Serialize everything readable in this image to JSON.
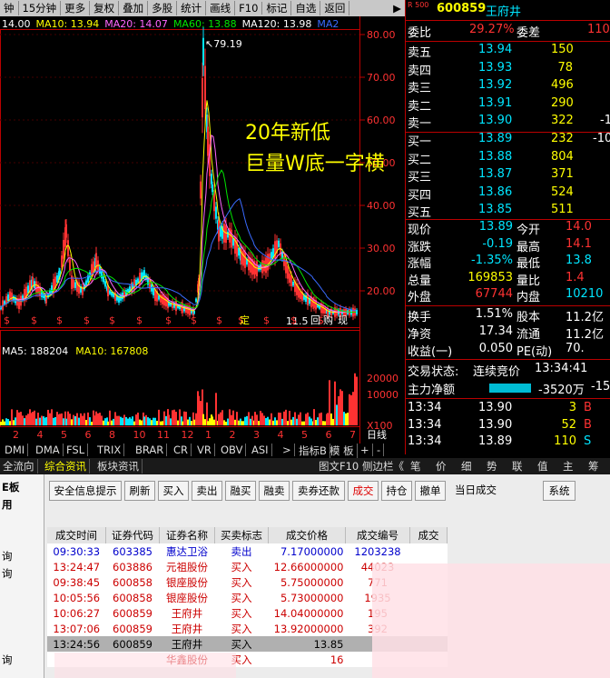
{
  "toolbar": {
    "items": [
      "钟",
      "15分钟",
      "更多",
      "复权",
      "叠加",
      "多股",
      "统计",
      "画线",
      "F10",
      "标记",
      "自选",
      "返回"
    ],
    "scroll_arrow": "▶"
  },
  "chart": {
    "ma_labels": [
      {
        "text": "14.00",
        "color": "#ffffff"
      },
      {
        "text": "MA10: 13.94",
        "color": "#ffff00"
      },
      {
        "text": "MA20: 14.07",
        "color": "#ff66ff"
      },
      {
        "text": "MA60: 13.88",
        "color": "#00e600"
      },
      {
        "text": "MA120: 13.98",
        "color": "#ffffff"
      },
      {
        "text": "MA2",
        "color": "#3a6bff"
      }
    ],
    "price_ticks": [
      "80.00",
      "70.00",
      "60.00",
      "50.00",
      "40.00",
      "30.00",
      "20.00"
    ],
    "high_label": "79.19",
    "low_label": "11.5",
    "annotation_line1": "20年新低",
    "annotation_line2": "巨量W底一字横",
    "marker_chars": [
      "$",
      "定",
      "回",
      "购",
      "现"
    ],
    "vol_labels": [
      {
        "text": "MA5: 188204",
        "color": "#ffffff"
      },
      {
        "text": "MA10: 167808",
        "color": "#ffff00"
      }
    ],
    "vol_ticks": [
      "20000",
      "10000",
      "X100"
    ],
    "x_labels": [
      "2",
      "4",
      "5",
      "6",
      "8",
      "10",
      "11",
      "12",
      "1",
      "2",
      "3",
      "4",
      "5",
      "6",
      "7"
    ],
    "x_unit": "日线",
    "colors": {
      "up": "#ff3232",
      "down": "#00e5ff",
      "ma10": "#ffff00",
      "ma20": "#ff66ff",
      "ma60": "#00e600",
      "ma_long": "#3a6bff"
    }
  },
  "indicator_tabs": [
    "DMI",
    "DMA",
    "FSL",
    "TRIX",
    "BRAR",
    "CR",
    "VR",
    "OBV",
    "ASI",
    ">",
    "指标B",
    "模 板",
    "+",
    "-"
  ],
  "quote": {
    "code": "600859",
    "name": "王府井",
    "tag": "R 500",
    "weibi_label": "委比",
    "weibi_value": "29.27%",
    "weicha_label": "委差",
    "weicha_value": "110",
    "asks": [
      {
        "label": "卖五",
        "price": "13.94",
        "vol": "150",
        "extra": ""
      },
      {
        "label": "卖四",
        "price": "13.93",
        "vol": "78",
        "extra": ""
      },
      {
        "label": "卖三",
        "price": "13.92",
        "vol": "496",
        "extra": ""
      },
      {
        "label": "卖二",
        "price": "13.91",
        "vol": "290",
        "extra": ""
      },
      {
        "label": "卖一",
        "price": "13.90",
        "vol": "322",
        "extra": "-1"
      }
    ],
    "bids": [
      {
        "label": "买一",
        "price": "13.89",
        "vol": "232",
        "extra": "-10"
      },
      {
        "label": "买二",
        "price": "13.88",
        "vol": "804",
        "extra": ""
      },
      {
        "label": "买三",
        "price": "13.87",
        "vol": "371",
        "extra": ""
      },
      {
        "label": "买四",
        "price": "13.86",
        "vol": "524",
        "extra": ""
      },
      {
        "label": "买五",
        "price": "13.85",
        "vol": "511",
        "extra": ""
      }
    ],
    "stats": [
      {
        "l1": "现价",
        "v1": "13.89",
        "c1": "#00e5ff",
        "l2": "今开",
        "v2": "14.0",
        "c2": "#ff3232"
      },
      {
        "l1": "涨跌",
        "v1": "-0.19",
        "c1": "#00e5ff",
        "l2": "最高",
        "v2": "14.1",
        "c2": "#ff3232"
      },
      {
        "l1": "涨幅",
        "v1": "-1.35%",
        "c1": "#00e5ff",
        "l2": "最低",
        "v2": "13.8",
        "c2": "#00e5ff"
      },
      {
        "l1": "总量",
        "v1": "169853",
        "c1": "#ffff00",
        "l2": "量比",
        "v2": "1.4",
        "c2": "#ff3232"
      },
      {
        "l1": "外盘",
        "v1": "67744",
        "c1": "#ff3232",
        "l2": "内盘",
        "v2": "10210",
        "c2": "#00e5ff"
      }
    ],
    "stats2": [
      {
        "l1": "换手",
        "v1": "1.51%",
        "l2": "股本",
        "v2": "11.2亿"
      },
      {
        "l1": "净资",
        "v1": "17.34",
        "l2": "流通",
        "v2": "11.2亿"
      },
      {
        "l1": "收益(一)",
        "v1": "0.050",
        "l2": "PE(动)",
        "v2": "70."
      }
    ],
    "trade_status_label": "交易状态:",
    "trade_status": "连续竞价",
    "trade_time": "13:34:41",
    "main_flow_label": "主力净额",
    "main_flow_value": "-3520万",
    "main_flow_pct": "-15",
    "ticks": [
      {
        "time": "13:34",
        "price": "13.90",
        "vol": "3",
        "side": "B"
      },
      {
        "time": "13:34",
        "price": "13.90",
        "vol": "52",
        "side": "B"
      },
      {
        "time": "13:34",
        "price": "13.89",
        "vol": "110",
        "side": "S"
      }
    ],
    "side_tabs": [
      "笔",
      "价",
      "细",
      "势",
      "联",
      "值",
      "主",
      "筹"
    ]
  },
  "lower_tabs": [
    "全流向",
    "综合资讯",
    "板块资讯"
  ],
  "lower_right_tabs": [
    "图文F10",
    "侧边栏《"
  ],
  "trade_panel": {
    "side_items": [
      "E板",
      "用",
      "",
      "",
      "询",
      "询",
      "",
      "",
      "",
      "",
      "询"
    ],
    "buttons": [
      "安全信息提示",
      "刷新",
      "买入",
      "卖出",
      "融买",
      "融卖",
      "卖券还款",
      "成交",
      "持仓",
      "撤单",
      "当日成交",
      "系统"
    ],
    "active_button": "成交",
    "columns": [
      "成交时间",
      "证券代码",
      "证券名称",
      "买卖标志",
      "成交价格",
      "成交编号",
      "成交"
    ],
    "rows": [
      {
        "time": "09:30:33",
        "code": "603385",
        "name": "惠达卫浴",
        "side": "卖出",
        "price": "7.17000000",
        "no": "1203238",
        "color": "#0000cc"
      },
      {
        "time": "13:24:47",
        "code": "603886",
        "name": "元祖股份",
        "side": "买入",
        "price": "12.66000000",
        "no": "44023",
        "color": "#cc0000"
      },
      {
        "time": "09:38:45",
        "code": "600858",
        "name": "银座股份",
        "side": "买入",
        "price": "5.75000000",
        "no": "771",
        "color": "#cc0000"
      },
      {
        "time": "10:05:56",
        "code": "600858",
        "name": "银座股份",
        "side": "买入",
        "price": "5.73000000",
        "no": "1935",
        "color": "#cc0000"
      },
      {
        "time": "10:06:27",
        "code": "600859",
        "name": "王府井",
        "side": "买入",
        "price": "14.04000000",
        "no": "195",
        "color": "#cc0000"
      },
      {
        "time": "13:07:06",
        "code": "600859",
        "name": "王府井",
        "side": "买入",
        "price": "13.92000000",
        "no": "392",
        "color": "#cc0000"
      },
      {
        "time": "13:24:56",
        "code": "600859",
        "name": "王府井",
        "side": "买入",
        "price": "13.85",
        "no": "",
        "color": "#000000"
      },
      {
        "time": "",
        "code": "",
        "name": "华鑫股份",
        "side": "买入",
        "price": "16",
        "no": "",
        "color": "#cc0000"
      }
    ]
  }
}
